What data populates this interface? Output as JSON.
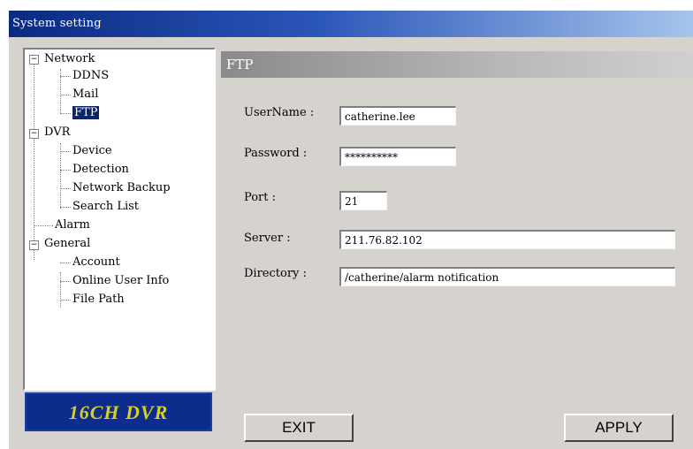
{
  "window": {
    "title": "System setting"
  },
  "tree": {
    "items": [
      {
        "label": "Network",
        "expander": "−"
      },
      {
        "label": "DDNS"
      },
      {
        "label": "Mail"
      },
      {
        "label": "FTP",
        "selected": true
      },
      {
        "label": "DVR",
        "expander": "−"
      },
      {
        "label": "Device"
      },
      {
        "label": "Detection"
      },
      {
        "label": "Network Backup"
      },
      {
        "label": "Search List"
      },
      {
        "label": "Alarm"
      },
      {
        "label": "General",
        "expander": "−"
      },
      {
        "label": "Account"
      },
      {
        "label": "Online User Info"
      },
      {
        "label": "File Path"
      }
    ]
  },
  "logo": {
    "text": "16CH DVR",
    "color": "#d8d020",
    "background": "#0e2c8c"
  },
  "ftp": {
    "section_title": "FTP",
    "username_label": "UserName :",
    "username_value": "catherine.lee",
    "password_label": "Password :",
    "password_value": "**********",
    "port_label": "Port :",
    "port_value": "21",
    "server_label": "Server :",
    "server_value": "211.76.82.102",
    "directory_label": "Directory :",
    "directory_value": "/catherine/alarm notification"
  },
  "buttons": {
    "exit_label": "EXIT",
    "apply_label": "APPLY"
  }
}
